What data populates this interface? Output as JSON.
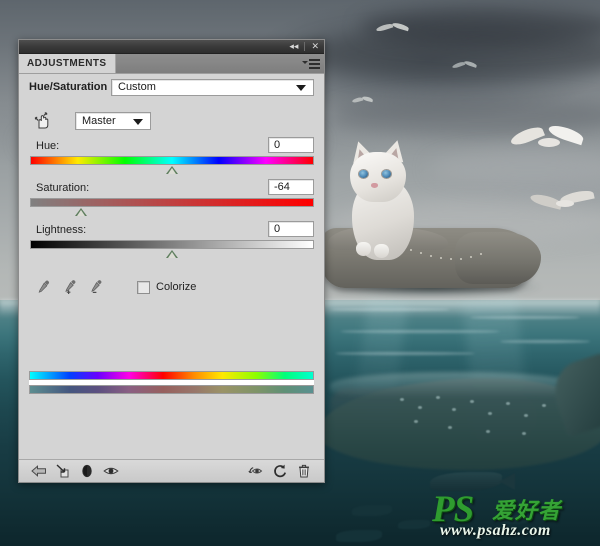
{
  "window": {
    "titlebar": {
      "collapse_label": "◂◂",
      "close_label": "✕",
      "collapse_icon": "double-chevron-left-icon",
      "close_icon": "close-icon"
    }
  },
  "panel": {
    "tab_label": "ADJUSTMENTS",
    "menu_icon": "panel-menu-icon",
    "adjustment_title": "Hue/Saturation",
    "preset": {
      "value": "Custom",
      "caret_icon": "chevron-down-icon"
    },
    "channel": {
      "tool_icon": "on-image-adjustment-hand-icon",
      "value": "Master",
      "caret_icon": "chevron-down-icon"
    },
    "sliders": [
      {
        "label": "Hue:",
        "value": "0",
        "percent": 50,
        "track": "hue"
      },
      {
        "label": "Saturation:",
        "value": "-64",
        "percent": 18,
        "track": "saturation"
      },
      {
        "label": "Lightness:",
        "value": "0",
        "percent": 50,
        "track": "lightness"
      }
    ],
    "tools": {
      "eyedropper": "eyedropper-icon",
      "eyedropper_add": "eyedropper-add-icon",
      "eyedropper_subtract": "eyedropper-subtract-icon",
      "colorize_label": "Colorize",
      "colorize_checked": false
    },
    "footer": {
      "back_icon": "return-to-adjustment-list-icon",
      "clip_icon": "clip-to-layer-icon",
      "mask_icon": "toggle-layer-mask-icon",
      "preview_icon": "toggle-layer-visibility-icon",
      "previous_state_icon": "view-previous-state-icon",
      "reset_icon": "reset-adjustment-icon",
      "delete_icon": "delete-adjustment-layer-icon"
    }
  },
  "watermark": {
    "logo": "PS",
    "chinese": "爱好者",
    "url": "www.psahz.com"
  },
  "colors": {
    "panel_bg": "#d4d4d4",
    "titlebar": "#3a3a3a",
    "thumb": "#5f7f5f",
    "watermark_green": "#2f9c2f",
    "sea": "#1d474f",
    "sky": "#9aa0a2"
  }
}
